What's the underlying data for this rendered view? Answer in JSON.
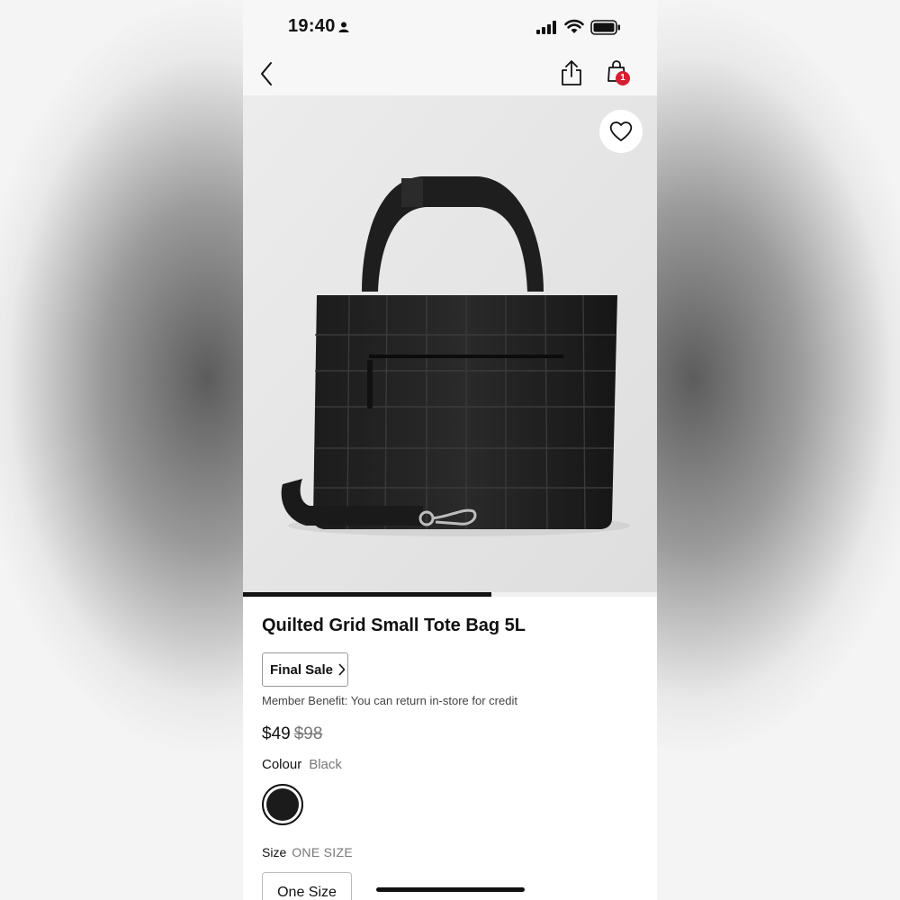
{
  "status_bar": {
    "time": "19:40"
  },
  "header": {
    "cart_count": "1"
  },
  "product": {
    "title": "Quilted Grid Small Tote Bag 5L",
    "final_sale_label": "Final Sale",
    "member_benefit": "Member Benefit: You can return in-store for credit",
    "price_sale": "$49",
    "price_original": "$98",
    "colour_label": "Colour",
    "colour_value": "Black",
    "size_label": "Size",
    "size_value": "ONE SIZE",
    "size_option": "One Size"
  },
  "carousel": {
    "progress": 0.6
  },
  "colors": {
    "accent_badge": "#d51f31",
    "swatch": "#1b1b1b"
  },
  "icons": [
    "person-icon",
    "signal-icon",
    "wifi-icon",
    "battery-icon",
    "back-icon",
    "share-icon",
    "shopping-bag-icon",
    "heart-icon",
    "chevron-right-icon"
  ]
}
